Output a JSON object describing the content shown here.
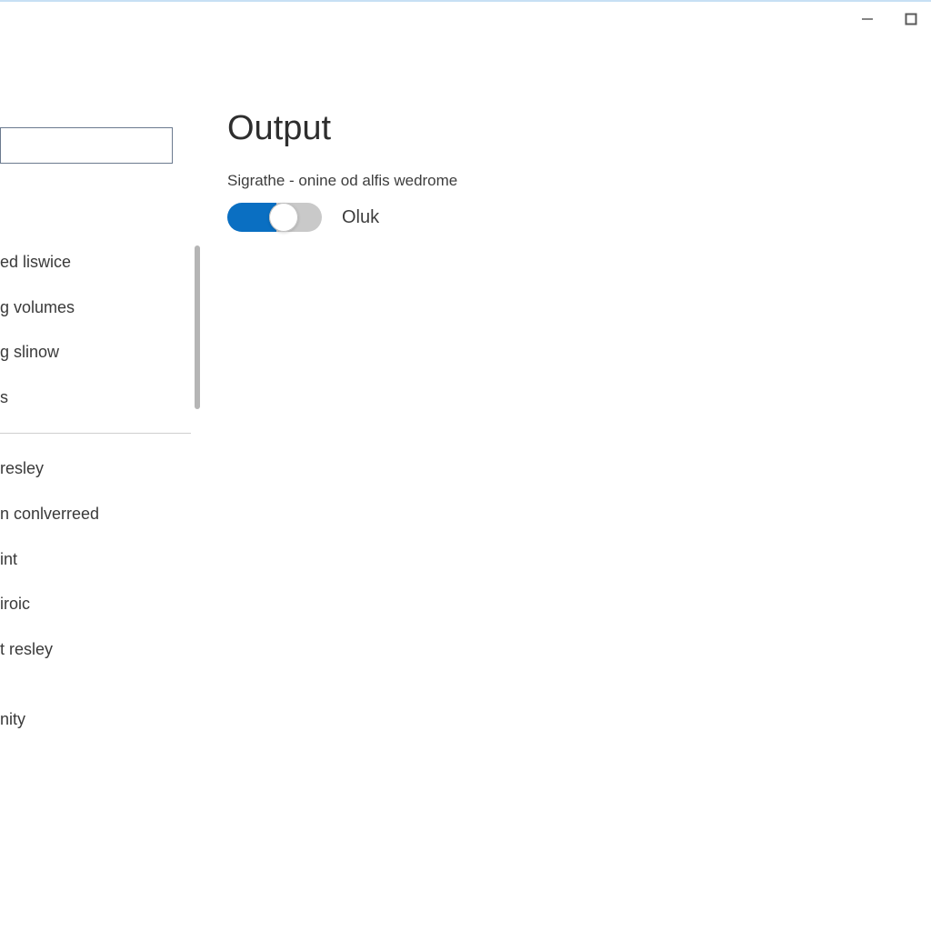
{
  "window": {
    "title": ""
  },
  "sidebar": {
    "search_placeholder": "",
    "groupA": [
      "",
      "",
      "ed liswice",
      "g volumes",
      "g slinow",
      "s"
    ],
    "groupB": [
      "resley",
      "n conlverreed",
      "int",
      "iroic",
      "t resley",
      "",
      "nity"
    ]
  },
  "main": {
    "heading": "Output",
    "setting_desc": "Sigrathe - onine od alfis wedrome",
    "toggle_state_label": "Oluk",
    "toggle_on": true
  },
  "colors": {
    "accent": "#0a6fc2",
    "text": "#3a3a3a"
  }
}
